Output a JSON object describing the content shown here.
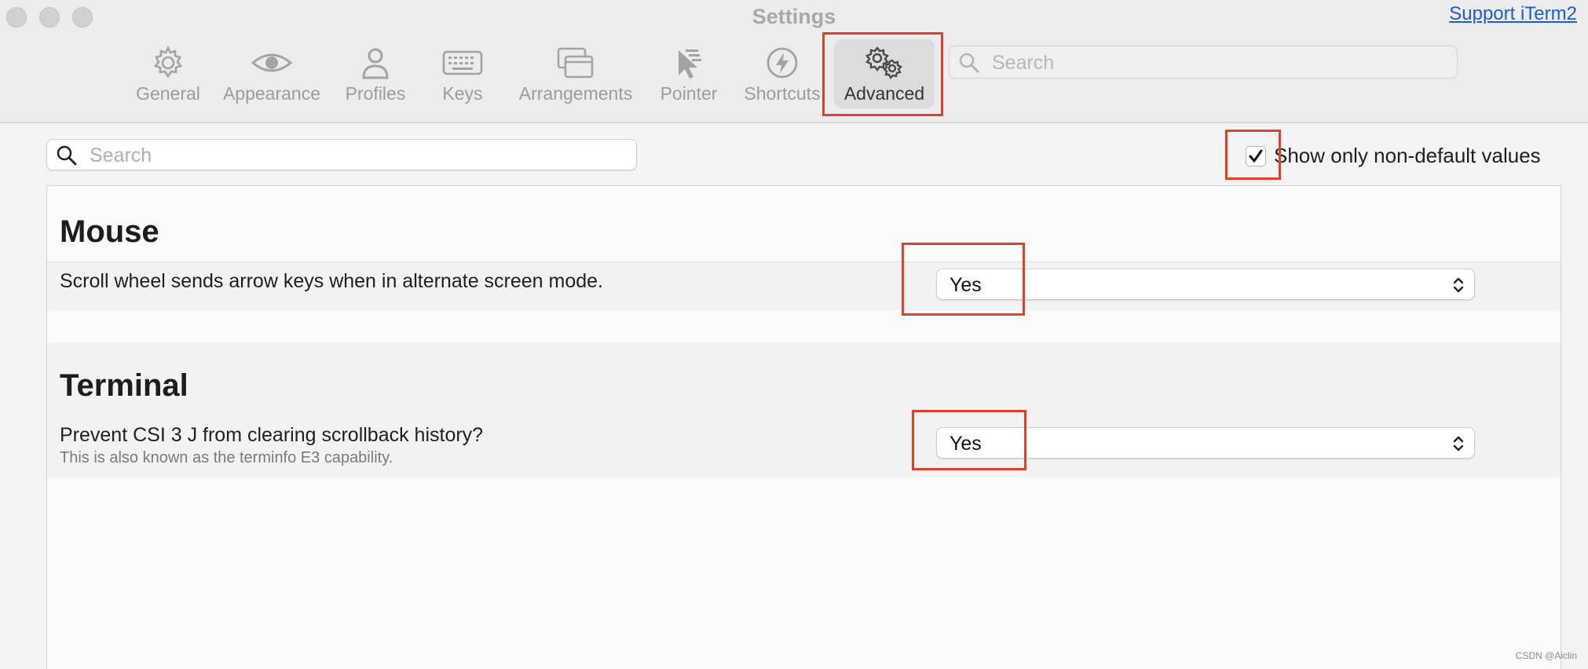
{
  "window": {
    "title": "Settings",
    "support_link": "Support iTerm2"
  },
  "toolbar": {
    "tabs": [
      {
        "label": "General",
        "icon": "gear-icon"
      },
      {
        "label": "Appearance",
        "icon": "eye-icon"
      },
      {
        "label": "Profiles",
        "icon": "person-icon"
      },
      {
        "label": "Keys",
        "icon": "keyboard-icon"
      },
      {
        "label": "Arrangements",
        "icon": "windows-icon"
      },
      {
        "label": "Pointer",
        "icon": "pointer-icon"
      },
      {
        "label": "Shortcuts",
        "icon": "lightning-icon"
      },
      {
        "label": "Advanced",
        "icon": "gears-icon",
        "selected": true
      }
    ],
    "search_placeholder": "Search"
  },
  "advanced": {
    "search_placeholder": "Search",
    "show_non_default": {
      "label": "Show only non-default values",
      "checked": true
    },
    "sections": [
      {
        "title": "Mouse",
        "settings": [
          {
            "label": "Scroll wheel sends arrow keys when in alternate screen mode.",
            "value": "Yes"
          }
        ]
      },
      {
        "title": "Terminal",
        "settings": [
          {
            "label": "Prevent CSI 3 J from clearing scrollback history?",
            "description": "This is also known as the terminfo E3 capability.",
            "value": "Yes"
          }
        ]
      }
    ]
  },
  "annotation_color": "#e0412a",
  "watermark": "CSDN @Aiclin"
}
